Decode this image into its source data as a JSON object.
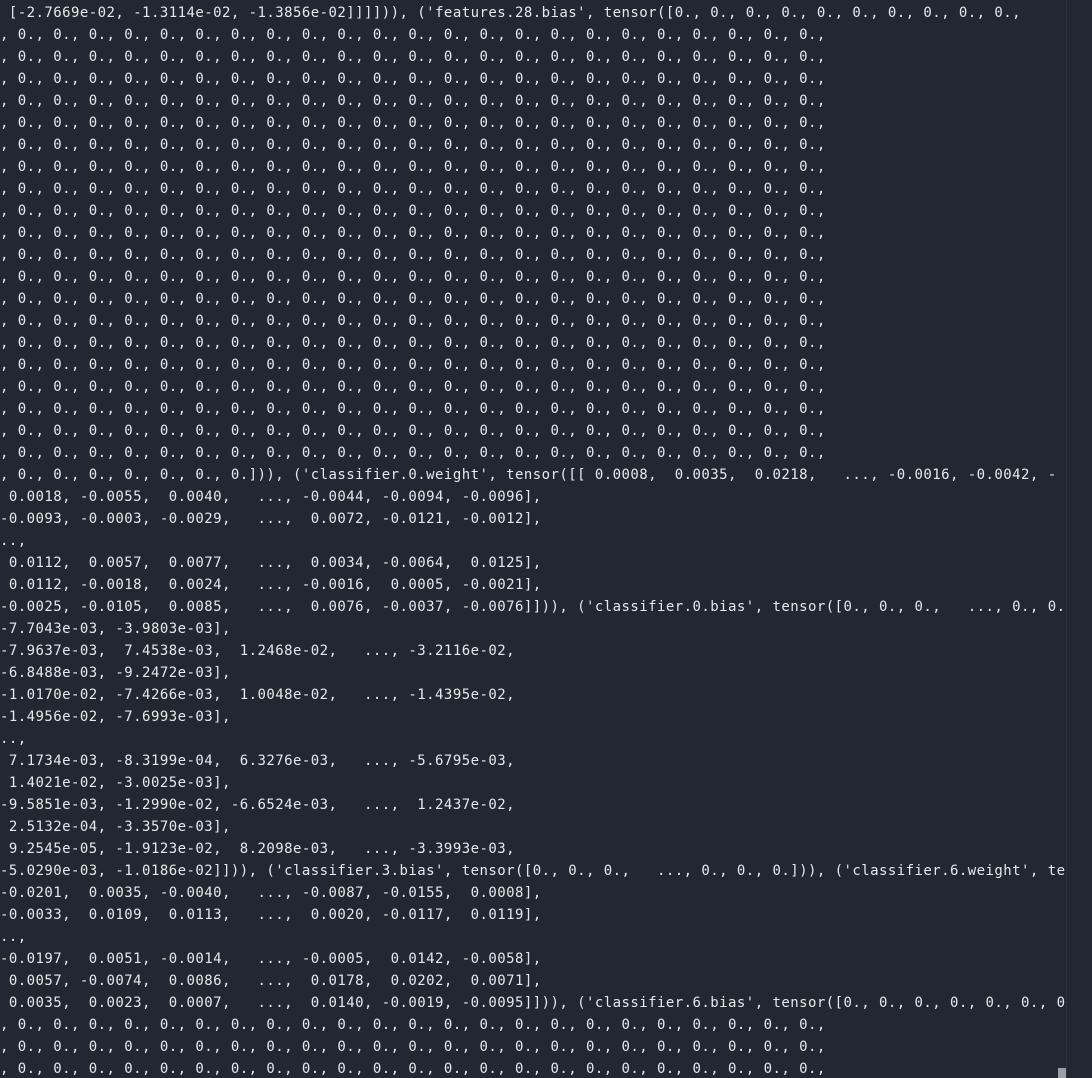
{
  "output": {
    "lines": [
      " [-2.7669e-02, -1.3114e-02, -1.3856e-02]]]])), ('features.28.bias', tensor([0., 0., 0., 0., 0., 0., 0., 0., 0., 0.,",
      ", 0., 0., 0., 0., 0., 0., 0., 0., 0., 0., 0., 0., 0., 0., 0., 0., 0., 0., 0., 0., 0., 0., 0.,",
      ", 0., 0., 0., 0., 0., 0., 0., 0., 0., 0., 0., 0., 0., 0., 0., 0., 0., 0., 0., 0., 0., 0., 0.,",
      ", 0., 0., 0., 0., 0., 0., 0., 0., 0., 0., 0., 0., 0., 0., 0., 0., 0., 0., 0., 0., 0., 0., 0.,",
      ", 0., 0., 0., 0., 0., 0., 0., 0., 0., 0., 0., 0., 0., 0., 0., 0., 0., 0., 0., 0., 0., 0., 0.,",
      ", 0., 0., 0., 0., 0., 0., 0., 0., 0., 0., 0., 0., 0., 0., 0., 0., 0., 0., 0., 0., 0., 0., 0.,",
      ", 0., 0., 0., 0., 0., 0., 0., 0., 0., 0., 0., 0., 0., 0., 0., 0., 0., 0., 0., 0., 0., 0., 0.,",
      ", 0., 0., 0., 0., 0., 0., 0., 0., 0., 0., 0., 0., 0., 0., 0., 0., 0., 0., 0., 0., 0., 0., 0.,",
      ", 0., 0., 0., 0., 0., 0., 0., 0., 0., 0., 0., 0., 0., 0., 0., 0., 0., 0., 0., 0., 0., 0., 0.,",
      ", 0., 0., 0., 0., 0., 0., 0., 0., 0., 0., 0., 0., 0., 0., 0., 0., 0., 0., 0., 0., 0., 0., 0.,",
      ", 0., 0., 0., 0., 0., 0., 0., 0., 0., 0., 0., 0., 0., 0., 0., 0., 0., 0., 0., 0., 0., 0., 0.,",
      ", 0., 0., 0., 0., 0., 0., 0., 0., 0., 0., 0., 0., 0., 0., 0., 0., 0., 0., 0., 0., 0., 0., 0.,",
      ", 0., 0., 0., 0., 0., 0., 0., 0., 0., 0., 0., 0., 0., 0., 0., 0., 0., 0., 0., 0., 0., 0., 0.,",
      ", 0., 0., 0., 0., 0., 0., 0., 0., 0., 0., 0., 0., 0., 0., 0., 0., 0., 0., 0., 0., 0., 0., 0.,",
      ", 0., 0., 0., 0., 0., 0., 0., 0., 0., 0., 0., 0., 0., 0., 0., 0., 0., 0., 0., 0., 0., 0., 0.,",
      ", 0., 0., 0., 0., 0., 0., 0., 0., 0., 0., 0., 0., 0., 0., 0., 0., 0., 0., 0., 0., 0., 0., 0.,",
      ", 0., 0., 0., 0., 0., 0., 0., 0., 0., 0., 0., 0., 0., 0., 0., 0., 0., 0., 0., 0., 0., 0., 0.,",
      ", 0., 0., 0., 0., 0., 0., 0., 0., 0., 0., 0., 0., 0., 0., 0., 0., 0., 0., 0., 0., 0., 0., 0.,",
      ", 0., 0., 0., 0., 0., 0., 0., 0., 0., 0., 0., 0., 0., 0., 0., 0., 0., 0., 0., 0., 0., 0., 0.,",
      ", 0., 0., 0., 0., 0., 0., 0., 0., 0., 0., 0., 0., 0., 0., 0., 0., 0., 0., 0., 0., 0., 0., 0.,",
      ", 0., 0., 0., 0., 0., 0., 0., 0., 0., 0., 0., 0., 0., 0., 0., 0., 0., 0., 0., 0., 0., 0., 0.,",
      ", 0., 0., 0., 0., 0., 0., 0.])), ('classifier.0.weight', tensor([[ 0.0008,  0.0035,  0.0218,   ..., -0.0016, -0.0042, -",
      " 0.0018, -0.0055,  0.0040,   ..., -0.0044, -0.0094, -0.0096],",
      "-0.0093, -0.0003, -0.0029,   ...,  0.0072, -0.0121, -0.0012],",
      "..,",
      " 0.0112,  0.0057,  0.0077,   ...,  0.0034, -0.0064,  0.0125],",
      " 0.0112, -0.0018,  0.0024,   ..., -0.0016,  0.0005, -0.0021],",
      "-0.0025, -0.0105,  0.0085,   ...,  0.0076, -0.0037, -0.0076]])), ('classifier.0.bias', tensor([0., 0., 0.,   ..., 0., 0.,",
      "-7.7043e-03, -3.9803e-03],",
      "-7.9637e-03,  7.4538e-03,  1.2468e-02,   ..., -3.2116e-02,",
      "-6.8488e-03, -9.2472e-03],",
      "-1.0170e-02, -7.4266e-03,  1.0048e-02,   ..., -1.4395e-02,",
      "-1.4956e-02, -7.6993e-03],",
      "..,",
      " 7.1734e-03, -8.3199e-04,  6.3276e-03,   ..., -5.6795e-03,",
      " 1.4021e-02, -3.0025e-03],",
      "-9.5851e-03, -1.2990e-02, -6.6524e-03,   ...,  1.2437e-02,",
      " 2.5132e-04, -3.3570e-03],",
      " 9.2545e-05, -1.9123e-02,  8.2098e-03,   ..., -3.3993e-03,",
      "-5.0290e-03, -1.0186e-02]])), ('classifier.3.bias', tensor([0., 0., 0.,   ..., 0., 0., 0.])), ('classifier.6.weight', te",
      "-0.0201,  0.0035, -0.0040,   ..., -0.0087, -0.0155,  0.0008],",
      "-0.0033,  0.0109,  0.0113,   ...,  0.0020, -0.0117,  0.0119],",
      "..,",
      "-0.0197,  0.0051, -0.0014,   ..., -0.0005,  0.0142, -0.0058],",
      " 0.0057, -0.0074,  0.0086,   ...,  0.0178,  0.0202,  0.0071],",
      " 0.0035,  0.0023,  0.0007,   ...,  0.0140, -0.0019, -0.0095]])), ('classifier.6.bias', tensor([0., 0., 0., 0., 0., 0., 0",
      ", 0., 0., 0., 0., 0., 0., 0., 0., 0., 0., 0., 0., 0., 0., 0., 0., 0., 0., 0., 0., 0., 0., 0.,",
      ", 0., 0., 0., 0., 0., 0., 0., 0., 0., 0., 0., 0., 0., 0., 0., 0., 0., 0., 0., 0., 0., 0., 0.,",
      ", 0., 0., 0., 0., 0., 0., 0., 0., 0., 0., 0., 0., 0., 0., 0., 0., 0., 0., 0., 0., 0., 0., 0.,"
    ]
  },
  "scrollbar": {
    "position_fraction": 1.0
  },
  "colors": {
    "background": "#222831",
    "text": "#e6e8ea",
    "scrollbar_thumb": "#9aa0a6"
  }
}
